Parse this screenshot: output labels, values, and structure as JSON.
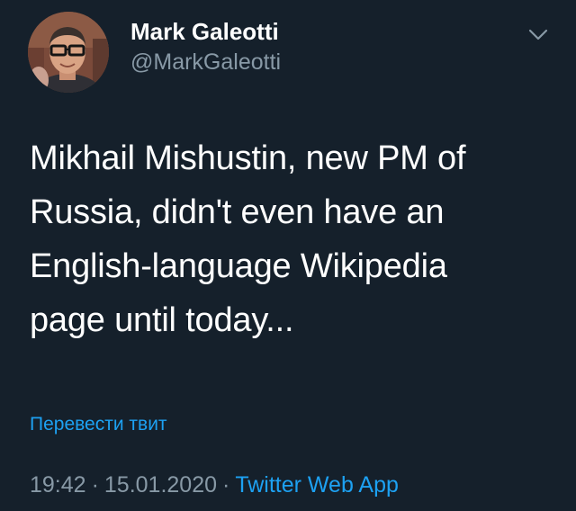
{
  "tweet": {
    "author": {
      "display_name": "Mark Galeotti",
      "handle": "@MarkGaleotti",
      "avatar_icon": "profile-photo"
    },
    "menu_icon": "chevron-down-icon",
    "text": "Mikhail Mishustin, new PM of\nRussia, didn't even have an\nEnglish-language Wikipedia\npage until today...",
    "translate_label": "Перевести твит",
    "time": "19:42",
    "separator": "·",
    "date": "15.01.2020",
    "source": "Twitter Web App"
  },
  "colors": {
    "background": "#15202b",
    "primary_text": "#ffffff",
    "secondary_text": "#8899a6",
    "accent": "#1da1f2"
  }
}
